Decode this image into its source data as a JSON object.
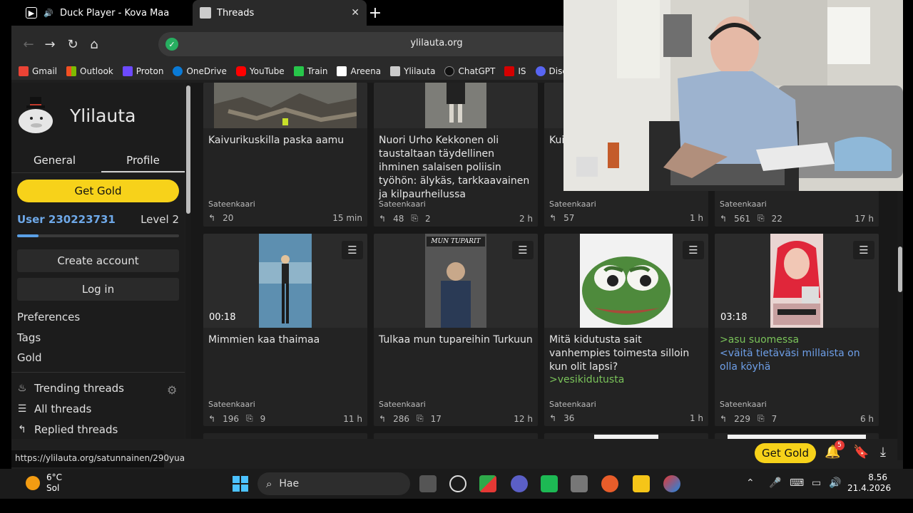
{
  "tabs": [
    {
      "title": "Duck Player - Kova Maa",
      "active": false
    },
    {
      "title": "Threads",
      "active": true
    }
  ],
  "nav": {
    "url": "ylilauta.org"
  },
  "bookmarks": [
    {
      "label": "Gmail",
      "color": "#ea4335"
    },
    {
      "label": "Outlook",
      "color": "#f25022"
    },
    {
      "label": "Proton",
      "color": "#6d4aff"
    },
    {
      "label": "OneDrive",
      "color": "#0a7ad6"
    },
    {
      "label": "YouTube",
      "color": "#ff0000"
    },
    {
      "label": "Train",
      "color": "#27c64a"
    },
    {
      "label": "Areena",
      "color": "#ffffff"
    },
    {
      "label": "Ylilauta",
      "color": "#cccccc"
    },
    {
      "label": "ChatGPT",
      "color": "#1f1f1f"
    },
    {
      "label": "IS",
      "color": "#d50000"
    },
    {
      "label": "Discord",
      "color": "#5865f2"
    }
  ],
  "sidebar": {
    "site_name": "Ylilauta",
    "tab_general": "General",
    "tab_profile": "Profile",
    "get_gold": "Get Gold",
    "user": "User 230223731",
    "level": "Level 2",
    "xp_progress": 0.13,
    "create_account": "Create account",
    "log_in": "Log in",
    "links": [
      "Preferences",
      "Tags",
      "Gold"
    ],
    "trending": "Trending threads",
    "all_threads": "All threads",
    "replied_threads": "Replied threads"
  },
  "cards_row1": [
    {
      "title": "Kaivurikuskilla paska aamu",
      "author": "Sateenkaari",
      "replies": "20",
      "images": "",
      "time": "15 min"
    },
    {
      "title": "Nuori Urho Kekkonen oli taustaltaan täydellinen ihminen salaisen poliisin työhön: älykäs, tarkkaavainen ja kilpaurheilussa",
      "author": "Sateenkaari",
      "replies": "48",
      "images": "2",
      "time": "2 h"
    },
    {
      "title": "Kui",
      "author": "Sateenkaari",
      "replies": "57",
      "images": "",
      "time": "1 h"
    },
    {
      "title": "",
      "author": "Sateenkaari",
      "replies": "561",
      "images": "22",
      "time": "17 h"
    }
  ],
  "cards_row2": [
    {
      "title": "Mimmien kaa thaimaa",
      "duration": "00:18",
      "author": "Sateenkaari",
      "replies": "196",
      "images": "9",
      "time": "11 h"
    },
    {
      "title": "Tulkaa mun tupareihin Turkuun",
      "thumb_text": "MUN TUPARIT",
      "author": "Sateenkaari",
      "replies": "286",
      "images": "17",
      "time": "12 h"
    },
    {
      "title": "Mitä kidutusta sait vanhempies toimesta silloin kun olit lapsi?",
      "greentext": ">vesikidutusta",
      "author": "Sateenkaari",
      "replies": "36",
      "images": "",
      "time": "1 h"
    },
    {
      "greentext": ">asu suomessa",
      "bluetext": "<väitä tietäväsi millaista on olla köyhä",
      "duration": "03:18",
      "author": "Sateenkaari",
      "replies": "229",
      "images": "7",
      "time": "6 h"
    }
  ],
  "status_url": "https://ylilauta.org/satunnainen/290yua",
  "bottom": {
    "get_gold": "Get Gold",
    "notifications": "5"
  },
  "taskbar": {
    "temp": "6°C",
    "weather": "Sol",
    "search": "Hae",
    "time": "8.56",
    "date": "21.4.2026"
  }
}
